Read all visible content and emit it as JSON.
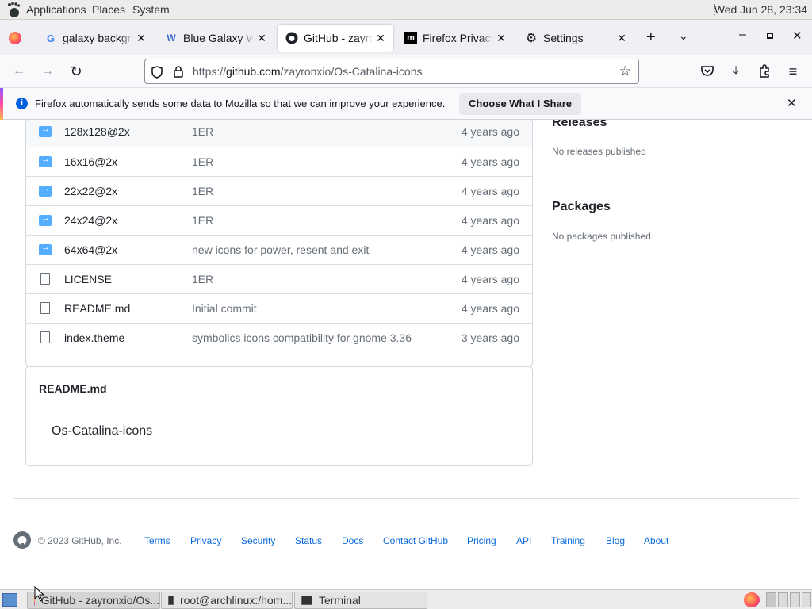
{
  "topbar": {
    "menus": [
      "Applications",
      "Places",
      "System"
    ],
    "clock": "Wed Jun 28, 23:34"
  },
  "tabs": [
    {
      "title": "galaxy background",
      "favicon": "google-icon",
      "active": false
    },
    {
      "title": "Blue Galaxy Wallpaper",
      "favicon": "wallpaper-icon",
      "active": false
    },
    {
      "title": "GitHub - zayronxio",
      "favicon": "github-icon",
      "active": true
    },
    {
      "title": "Firefox Privacy Notice",
      "favicon": "mozilla-icon",
      "active": false
    },
    {
      "title": "Settings",
      "favicon": "gear-icon",
      "active": false
    }
  ],
  "navbar": {
    "url_prefix": "https://",
    "url_domain": "github.com",
    "url_path": "/zayronxio/Os-Catalina-icons"
  },
  "notice": {
    "message": "Firefox automatically sends some data to Mozilla so that we can improve your experience.",
    "button": "Choose What I Share"
  },
  "files": [
    {
      "name": "128x128@2x",
      "type": "folder",
      "message": "1ER",
      "age": "4 years ago"
    },
    {
      "name": "16x16@2x",
      "type": "folder",
      "message": "1ER",
      "age": "4 years ago"
    },
    {
      "name": "22x22@2x",
      "type": "folder",
      "message": "1ER",
      "age": "4 years ago"
    },
    {
      "name": "24x24@2x",
      "type": "folder",
      "message": "1ER",
      "age": "4 years ago"
    },
    {
      "name": "64x64@2x",
      "type": "folder",
      "message": "new icons for power, resent and exit",
      "age": "4 years ago"
    },
    {
      "name": "LICENSE",
      "type": "file",
      "message": "1ER",
      "age": "4 years ago"
    },
    {
      "name": "README.md",
      "type": "file",
      "message": "Initial commit",
      "age": "4 years ago"
    },
    {
      "name": "index.theme",
      "type": "file",
      "message": "symbolics icons compatibility for gnome 3.36",
      "age": "3 years ago"
    }
  ],
  "readme": {
    "header": "README.md",
    "body": "Os-Catalina-icons"
  },
  "sidebar": {
    "releases_title": "Releases",
    "releases_text": "No releases published",
    "packages_title": "Packages",
    "packages_text": "No packages published"
  },
  "footer": {
    "copyright": "© 2023 GitHub, Inc.",
    "links": [
      "Terms",
      "Privacy",
      "Security",
      "Status",
      "Docs",
      "Contact GitHub",
      "Pricing",
      "API",
      "Training",
      "Blog",
      "About"
    ]
  },
  "taskbar": {
    "tasks": [
      "GitHub - zayronxio/Os...",
      "root@archlinux:/hom...",
      "Terminal"
    ]
  },
  "colors": {
    "link": "#0969da",
    "folder": "#54aeff",
    "muted": "#656d76"
  }
}
